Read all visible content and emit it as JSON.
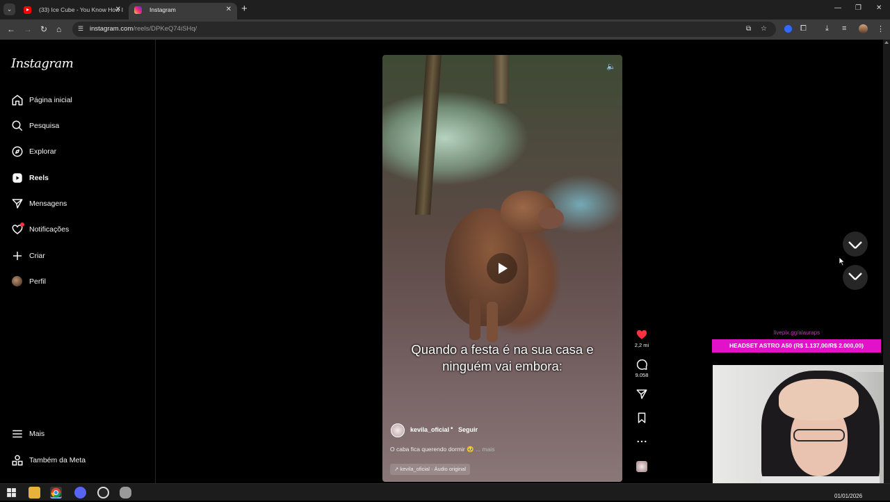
{
  "browser": {
    "tabs": [
      {
        "label": "(33) Ice Cube - You Know How I",
        "favicon": "youtube-icon"
      },
      {
        "label": "Instagram",
        "favicon": "instagram-icon"
      }
    ],
    "url": {
      "domain": "instagram.com",
      "path": "/reels/DPKeQ74iSHq/"
    }
  },
  "sidebar": {
    "logo": "Instagram",
    "items": [
      {
        "label": "Página inicial",
        "icon": "home-icon"
      },
      {
        "label": "Pesquisa",
        "icon": "search-icon"
      },
      {
        "label": "Explorar",
        "icon": "compass-icon"
      },
      {
        "label": "Reels",
        "icon": "reels-icon",
        "active": true
      },
      {
        "label": "Mensagens",
        "icon": "paper-plane-icon"
      },
      {
        "label": "Notificações",
        "icon": "heart-icon"
      },
      {
        "label": "Criar",
        "icon": "plus-icon"
      },
      {
        "label": "Perfil",
        "icon": "profile-avatar-icon"
      }
    ],
    "bottom": [
      {
        "label": "Mais",
        "icon": "menu-icon"
      },
      {
        "label": "Também da Meta",
        "icon": "meta-icon"
      }
    ]
  },
  "reel": {
    "caption_overlay": "Quando a festa é na sua casa e ninguém vai embora:",
    "author": "kevila_oficial",
    "separator": "•",
    "follow": "Seguir",
    "description": "O caba fica querendo dormir 🥹",
    "more": "... mais",
    "audio": "↗ kevila_oficial · Áudio original"
  },
  "actions": {
    "likes": "2,2 mi",
    "comments": "9.058"
  },
  "stream_overlay": {
    "link": "livepix.gg/alauraps",
    "banner": "HEADSET ASTRO A50 (R$ 1.137,00/R$ 2.000,00)"
  },
  "taskbar": {
    "date": "01/01/2026"
  },
  "colors": {
    "like_red": "#ff3040",
    "banner_magenta": "#e112c8"
  }
}
